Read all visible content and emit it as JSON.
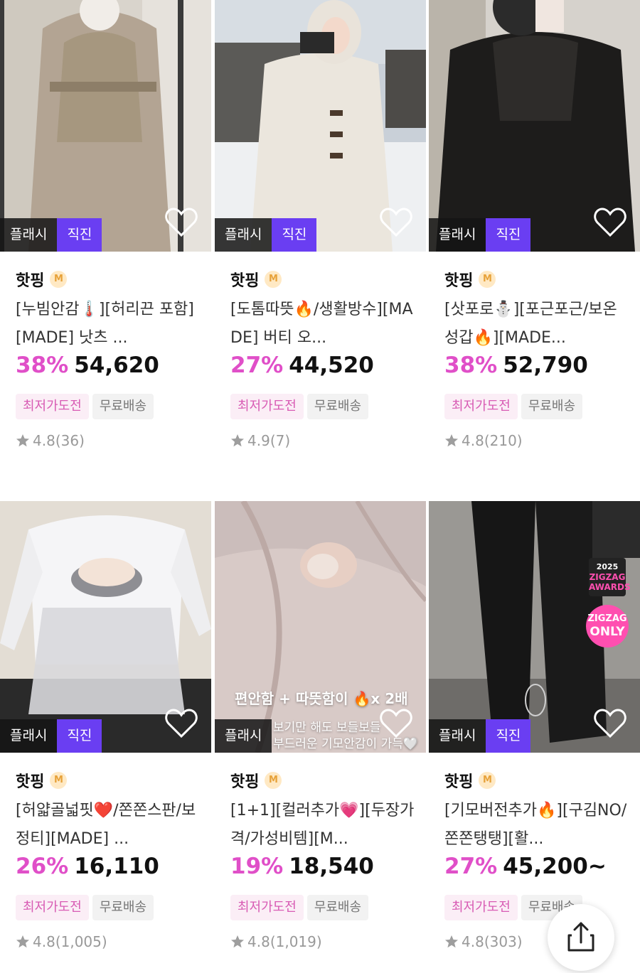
{
  "colors": {
    "discount": "#e04fc8",
    "direct_badge": "#6a3ef2",
    "flash_badge": "#141414",
    "tag_pink_text": "#d85bb4",
    "tag_pink_bg": "#fbeef6",
    "tag_gray_bg": "#f2f2f2"
  },
  "products": [
    {
      "badges": [
        "플래시",
        "직진"
      ],
      "store": "핫핑",
      "store_badge": "M",
      "title": "[누빔안감🌡️][허리끈 포함][MADE] 낫츠 ...",
      "discount": "38%",
      "price": "54,620",
      "tags": [
        "최저가도전",
        "무료배송"
      ],
      "rating": "4.8",
      "review_count": "(36)",
      "image_icon": "beige-trench-coat-photo"
    },
    {
      "badges": [
        "플래시",
        "직진"
      ],
      "store": "핫핑",
      "store_badge": "M",
      "title": "[도톰따뜻🔥/생활방수][MADE] 버티 오...",
      "discount": "27%",
      "price": "44,520",
      "tags": [
        "최저가도전",
        "무료배송"
      ],
      "rating": "4.9",
      "review_count": "(7)",
      "image_icon": "white-duffle-coat-photo"
    },
    {
      "badges": [
        "플래시",
        "직진"
      ],
      "store": "핫핑",
      "store_badge": "M",
      "title": "[삿포로⛄][포근포근/보온성갑🔥][MADE...",
      "discount": "38%",
      "price": "52,790",
      "tags": [
        "최저가도전",
        "무료배송"
      ],
      "rating": "4.8",
      "review_count": "(210)",
      "image_icon": "black-shearling-jacket-photo"
    },
    {
      "badges": [
        "플래시",
        "직진"
      ],
      "store": "핫핑",
      "store_badge": "M",
      "title": "[허얇골넓핏❤️/쫀쫀스판/보정티][MADE] ...",
      "discount": "26%",
      "price": "16,110",
      "tags": [
        "최저가도전",
        "무료배송"
      ],
      "rating": "4.8",
      "review_count": "(1,005)",
      "image_icon": "white-long-sleeve-top-photo"
    },
    {
      "badges": [
        "플래시"
      ],
      "store": "핫핑",
      "store_badge": "M",
      "title": "[1+1][컬러추가💗][두장가격/가성비템][M...",
      "discount": "19%",
      "price": "18,540",
      "tags": [
        "최저가도전",
        "무료배송"
      ],
      "rating": "4.8",
      "review_count": "(1,019)",
      "image_icon": "fleece-fabric-closeup-photo",
      "overlay": {
        "line1": "편안함 + 따뜻함이 🔥x 2배",
        "line2": "보기만 해도 보들보들",
        "line3": "부드러운 기모안감이 가득🤍"
      }
    },
    {
      "badges": [
        "플래시",
        "직진"
      ],
      "store": "핫핑",
      "store_badge": "M",
      "title": "[기모버전추가🔥][구김NO/쫀쫀탱탱][활...",
      "discount": "27%",
      "price": "45,200~",
      "tags": [
        "최저가도전",
        "무료배송"
      ],
      "rating": "4.8",
      "review_count": "(303)",
      "image_icon": "black-flare-pants-photo",
      "award": {
        "year": "2025",
        "line1": "ZIGZAG",
        "line2": "AWARDS"
      },
      "sticker": {
        "line1": "ZIGZAG",
        "line2": "ONLY"
      }
    }
  ],
  "share_button": {
    "icon": "share-icon"
  }
}
